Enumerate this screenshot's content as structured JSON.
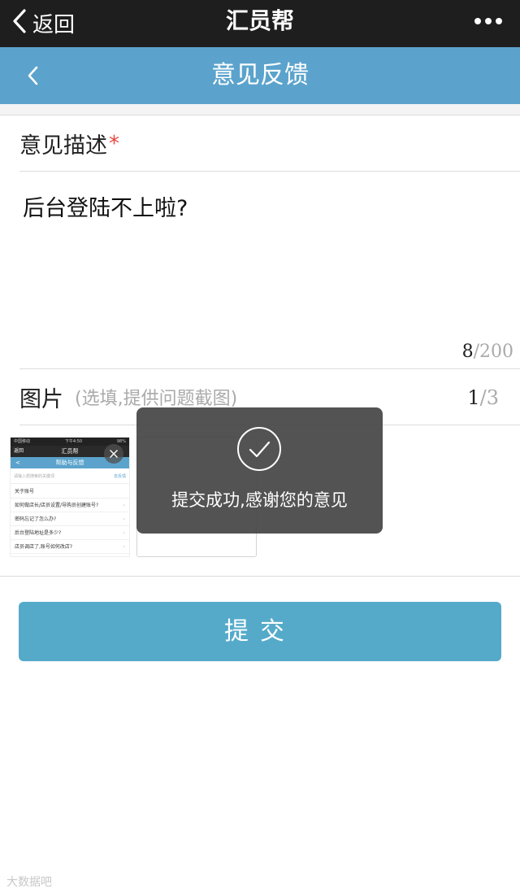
{
  "wechat_bar": {
    "back_label": "返回",
    "title": "汇员帮"
  },
  "page": {
    "title": "意见反馈"
  },
  "description": {
    "label": "意见描述",
    "required_mark": "*",
    "text": "后台登陆不上啦?",
    "count": "8",
    "max": "/200"
  },
  "images": {
    "label": "图片",
    "hint": "(选填,提供问题截图)",
    "count": "1",
    "max": "/3"
  },
  "thumbnail": {
    "status_left": "中国移动",
    "status_center": "下午4:50",
    "status_right": "98%",
    "nav_back": "返回",
    "nav_title": "汇员帮",
    "header_back": "<",
    "header_title": "帮助与反馈",
    "search_placeholder": "请输入想搜索的关键词",
    "feedback_link": "去反馈",
    "section_title": "关于账号",
    "items": [
      "如何做店长/店员设置/导购员创建账号?",
      "密码忘记了怎么办?",
      "后台登陆地址是多少?",
      "店员调店了,账号如何改店?"
    ],
    "arrow": "›"
  },
  "submit": {
    "label": "提交"
  },
  "toast": {
    "message": "提交成功,感谢您的意见"
  },
  "watermark": {
    "text": "大数据吧"
  }
}
